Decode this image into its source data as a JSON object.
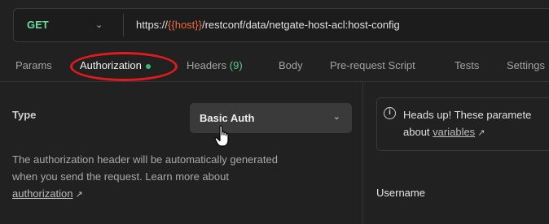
{
  "request": {
    "method": "GET",
    "url_prefix": "https://",
    "url_variable": "{{host}}",
    "url_suffix": "/restconf/data/netgate-host-acl:host-config"
  },
  "tabs": [
    {
      "label": "Params"
    },
    {
      "label": "Authorization",
      "active": true
    },
    {
      "label": "Headers",
      "count": "(9)"
    },
    {
      "label": "Body"
    },
    {
      "label": "Pre-request Script"
    },
    {
      "label": "Tests"
    },
    {
      "label": "Settings"
    }
  ],
  "auth": {
    "type_label": "Type",
    "type_value": "Basic Auth",
    "description_line1": "The authorization header will be automatically generated",
    "description_line2": "when you send the request. Learn more about",
    "learn_more_link": "authorization",
    "link_arrow": "↗"
  },
  "info": {
    "line1": "Heads up! These paramete",
    "line2_prefix": "about ",
    "variables_link": "variables",
    "link_arrow": "↗"
  },
  "fields": {
    "username_label": "Username"
  },
  "colors": {
    "background": "#212121",
    "method_get": "#6bdd9a",
    "url_variable": "#f26b3a",
    "active_dot": "#2fbf71",
    "headers_count": "#5cc98b",
    "annotation_circle": "#e01b1b"
  },
  "icons": {
    "method_dropdown": "chevron-down-icon",
    "type_dropdown": "chevron-down-icon",
    "info": "info-icon",
    "cursor": "hand-pointer-icon",
    "external_link": "arrow-up-right-icon"
  }
}
